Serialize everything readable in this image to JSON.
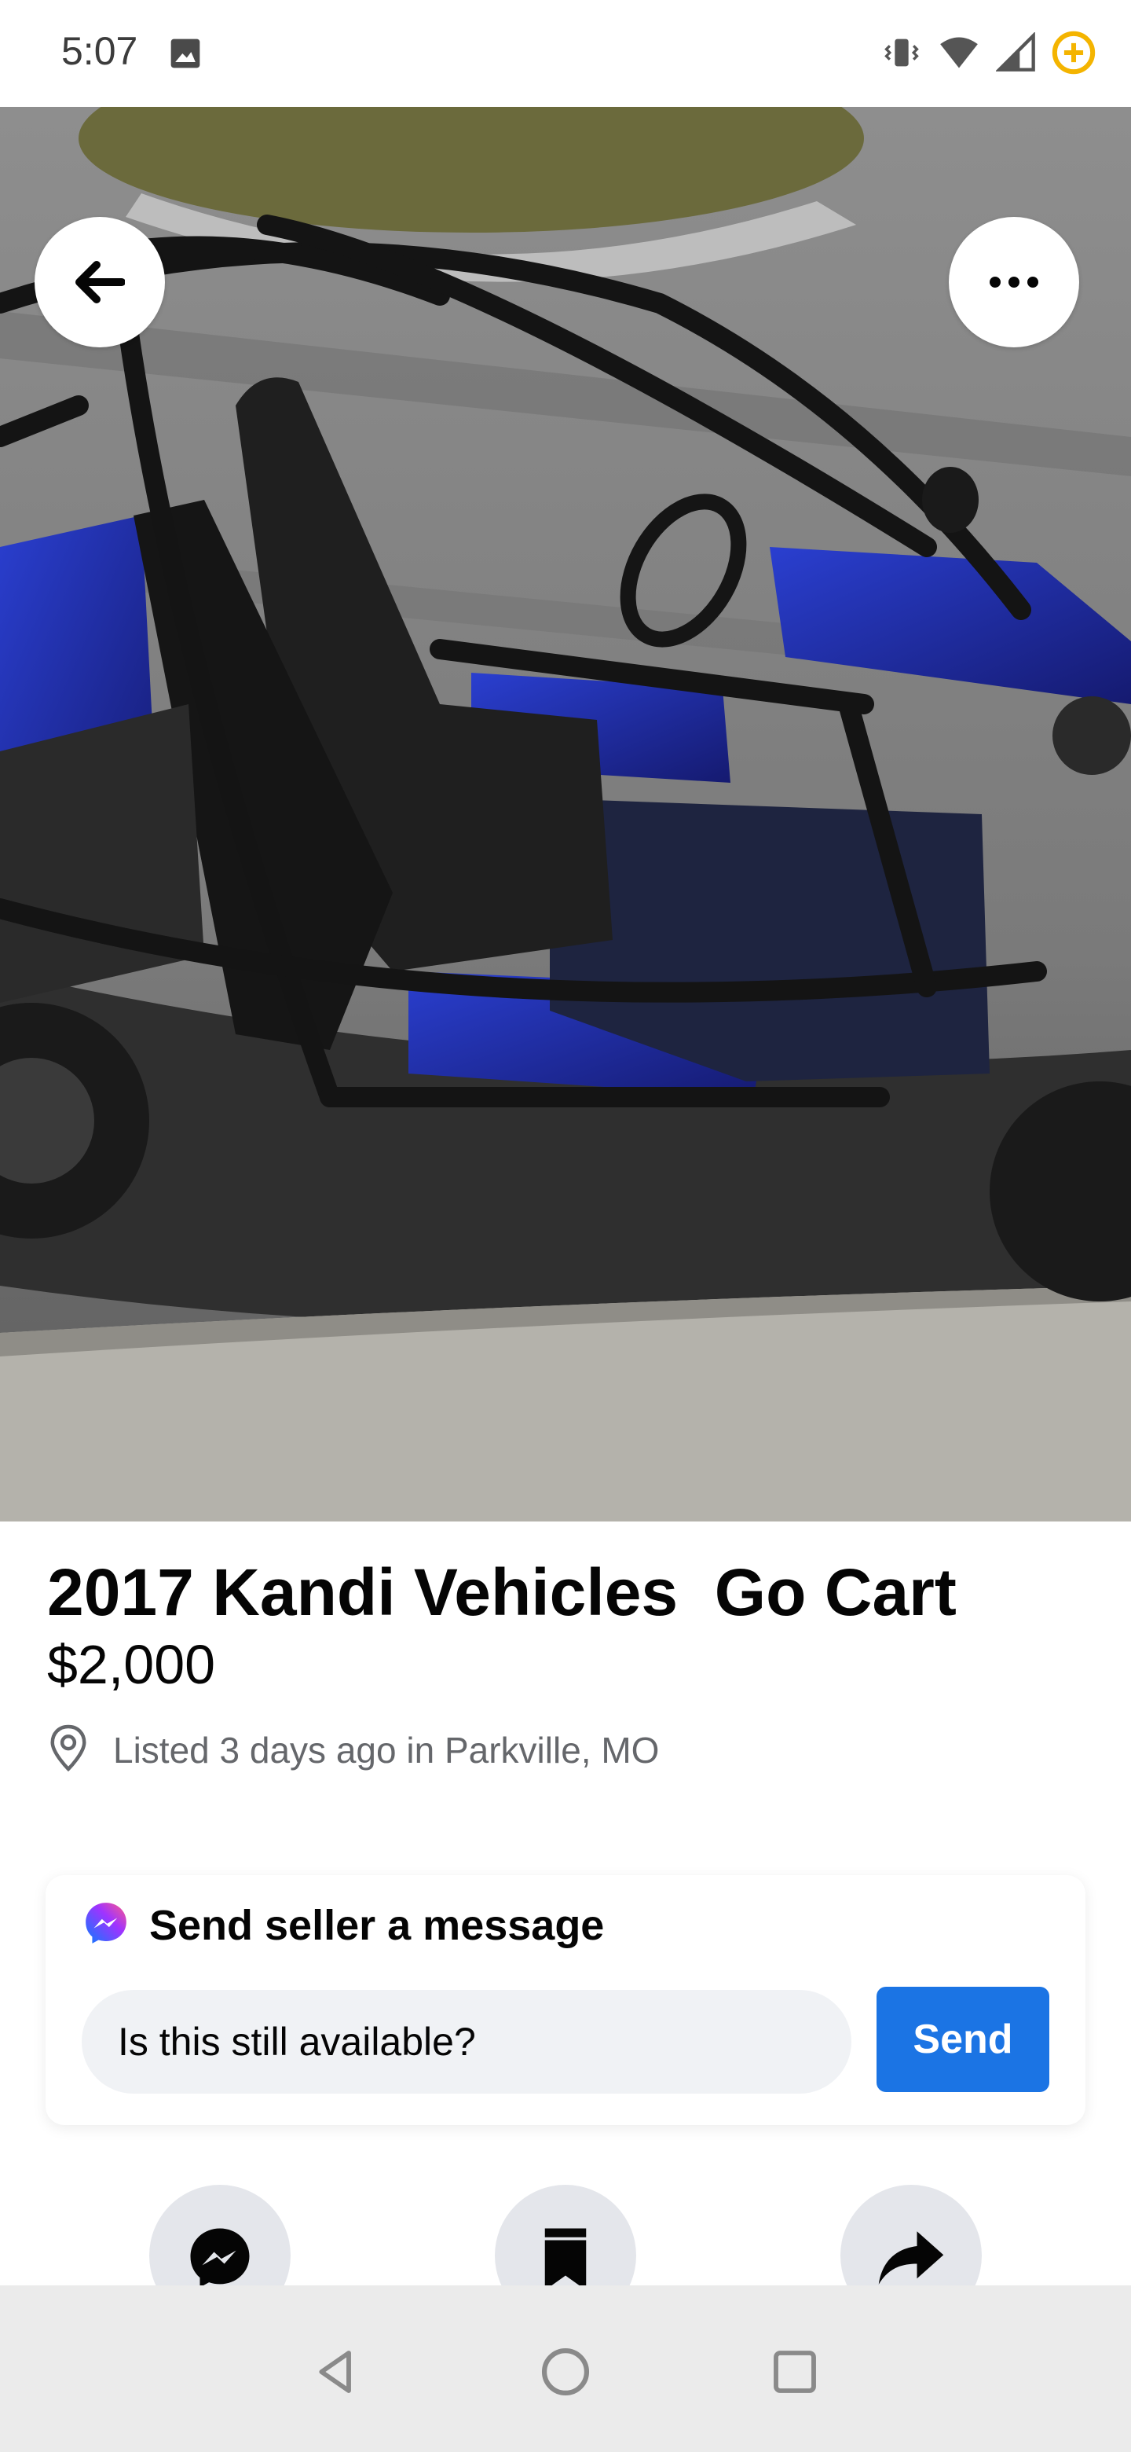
{
  "status_bar": {
    "time": "5:07"
  },
  "listing": {
    "title": "2017 Kandi Vehicles  Go Cart",
    "price": "$2,000",
    "location": "Listed 3 days ago in Parkville, MO"
  },
  "message_card": {
    "heading": "Send seller a message",
    "input_value": "Is this still available?",
    "send_label": "Send"
  },
  "actions": [
    {
      "icon": "messenger-icon"
    },
    {
      "icon": "save-bookmark-icon"
    },
    {
      "icon": "share-icon"
    }
  ],
  "colors": {
    "accent": "#1b74e4",
    "secondary_text": "#65676b",
    "input_bg": "#f0f2f5"
  }
}
